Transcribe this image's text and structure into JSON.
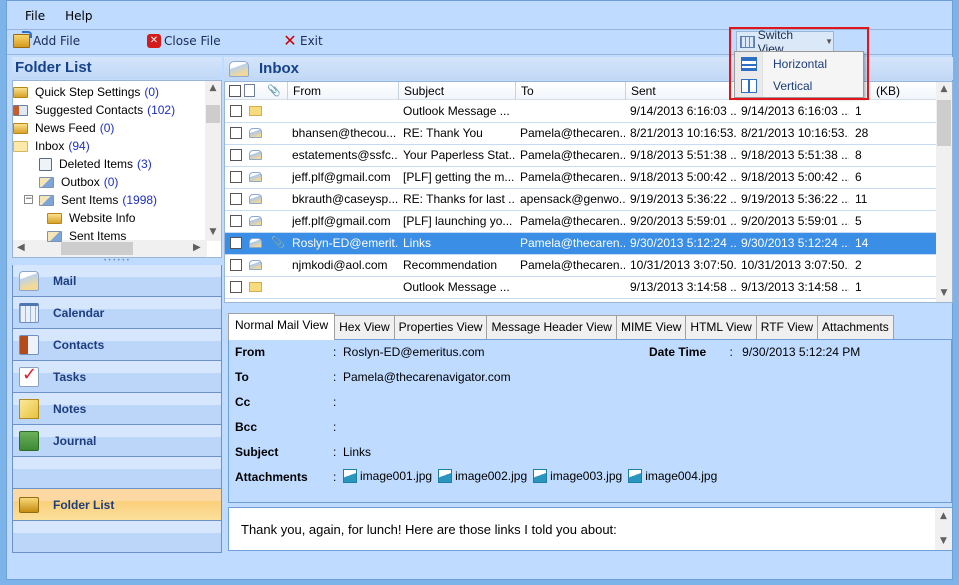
{
  "menu": {
    "items": [
      "File",
      "Help"
    ]
  },
  "toolbar": {
    "add_file": "Add File",
    "close_file": "Close File",
    "exit": "Exit",
    "switch_view": "Switch View"
  },
  "switch_view_menu": {
    "items": [
      {
        "label": "Horizontal",
        "icon": "horizontal-layout-icon"
      },
      {
        "label": "Vertical",
        "icon": "vertical-layout-icon"
      }
    ]
  },
  "folder_list": {
    "title": "Folder List",
    "items": [
      {
        "name": "Quick Step Settings",
        "count": "(0)",
        "icon": "folder-icon"
      },
      {
        "name": "Suggested Contacts",
        "count": "(102)",
        "icon": "contacts-icon"
      },
      {
        "name": "News Feed",
        "count": "(0)",
        "icon": "folder-icon"
      },
      {
        "name": "Inbox",
        "count": "(94)",
        "icon": "inbox-icon"
      },
      {
        "name": "Deleted Items",
        "count": "(3)",
        "icon": "deleted-items-icon"
      },
      {
        "name": "Outbox",
        "count": "(0)",
        "icon": "outbox-icon"
      },
      {
        "name": "Sent Items",
        "count": "(1998)",
        "icon": "sent-items-icon",
        "expander": "−"
      },
      {
        "name": "Website Info",
        "count": "",
        "icon": "folder-icon"
      },
      {
        "name": "Sent Items",
        "count": "",
        "icon": "sent-items-icon"
      }
    ]
  },
  "nav": {
    "items": [
      {
        "label": "Mail",
        "icon": "mail"
      },
      {
        "label": "Calendar",
        "icon": "calendar"
      },
      {
        "label": "Contacts",
        "icon": "contacts"
      },
      {
        "label": "Tasks",
        "icon": "tasks"
      },
      {
        "label": "Notes",
        "icon": "notes"
      },
      {
        "label": "Journal",
        "icon": "journal"
      }
    ],
    "active": {
      "label": "Folder List",
      "icon": "folderlist"
    }
  },
  "mailbox": {
    "title": "Inbox",
    "columns": {
      "from": "From",
      "subject": "Subject",
      "to": "To",
      "sent": "Sent",
      "size": "(KB)"
    },
    "rows": [
      {
        "read": false,
        "attach": false,
        "from": "",
        "subject": "Outlook Message ...",
        "to": "",
        "sent": "9/14/2013 6:16:03 ...",
        "received": "9/14/2013 6:16:03 ...",
        "size": "1"
      },
      {
        "read": true,
        "attach": false,
        "from": "bhansen@thecou...",
        "subject": "RE: Thank You",
        "to": "Pamela@thecaren...",
        "sent": "8/21/2013 10:16:53...",
        "received": "8/21/2013 10:16:53...",
        "size": "28"
      },
      {
        "read": true,
        "attach": false,
        "from": "estatements@ssfc...",
        "subject": "Your Paperless Stat...",
        "to": "Pamela@thecaren...",
        "sent": "9/18/2013 5:51:38 ...",
        "received": "9/18/2013 5:51:38 ...",
        "size": "8"
      },
      {
        "read": true,
        "attach": false,
        "from": "jeff.plf@gmail.com",
        "subject": "[PLF] getting the m...",
        "to": "Pamela@thecaren...",
        "sent": "9/18/2013 5:00:42 ...",
        "received": "9/18/2013 5:00:42 ...",
        "size": "6"
      },
      {
        "read": true,
        "attach": false,
        "from": "bkrauth@caseysp...",
        "subject": "RE: Thanks for last ...",
        "to": "apensack@genwo...",
        "sent": "9/19/2013 5:36:22 ...",
        "received": "9/19/2013 5:36:22 ...",
        "size": "11"
      },
      {
        "read": true,
        "attach": false,
        "from": "jeff.plf@gmail.com",
        "subject": "[PLF] launching yo...",
        "to": "Pamela@thecaren...",
        "sent": "9/20/2013 5:59:01 ...",
        "received": "9/20/2013 5:59:01 ...",
        "size": "5"
      },
      {
        "read": true,
        "attach": true,
        "selected": true,
        "from": "Roslyn-ED@emerit...",
        "subject": "Links",
        "to": "Pamela@thecaren...",
        "sent": "9/30/2013 5:12:24 ...",
        "received": "9/30/2013 5:12:24 ...",
        "size": "14"
      },
      {
        "read": true,
        "attach": false,
        "from": "njmkodi@aol.com",
        "subject": "Recommendation",
        "to": "Pamela@thecaren...",
        "sent": "10/31/2013 3:07:50...",
        "received": "10/31/2013 3:07:50...",
        "size": "2"
      },
      {
        "read": false,
        "attach": false,
        "from": "",
        "subject": "Outlook Message ...",
        "to": "",
        "sent": "9/13/2013 3:14:58 ...",
        "received": "9/13/2013 3:14:58 ...",
        "size": "1"
      }
    ]
  },
  "tabs": [
    "Normal Mail View",
    "Hex View",
    "Properties View",
    "Message Header View",
    "MIME View",
    "HTML View",
    "RTF View",
    "Attachments"
  ],
  "message": {
    "labels": {
      "from": "From",
      "to": "To",
      "cc": "Cc",
      "bcc": "Bcc",
      "subject": "Subject",
      "attachments": "Attachments",
      "datetime": "Date Time"
    },
    "colon": ":",
    "from": "Roslyn-ED@emeritus.com",
    "to": "Pamela@thecarenavigator.com",
    "cc": "",
    "bcc": "",
    "subject": "Links",
    "datetime": "9/30/2013 5:12:24 PM",
    "attachments": [
      "image001.jpg",
      "image002.jpg",
      "image003.jpg",
      "image004.jpg"
    ],
    "body": "Thank you, again, for lunch!  Here are those links I told you about:"
  },
  "colors": {
    "accent_selected_row": "#3a8ee6",
    "highlight_box": "#e2141c",
    "panel_bg": "#bfdbff"
  }
}
